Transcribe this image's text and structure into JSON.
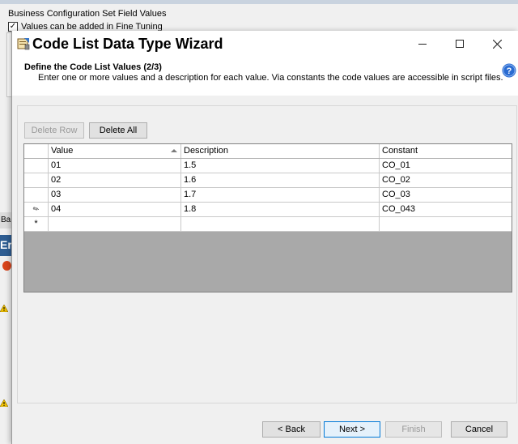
{
  "background": {
    "title": "Business Configuration Set Field Values",
    "checkbox_label": "Values can be added in Fine Tuning",
    "checkbox_checked": true,
    "tab_fragment": "Ba",
    "panel_fragment": "Er"
  },
  "dialog": {
    "title": "Code List Data Type Wizard",
    "step_title": "Define the Code List Values (2/3)",
    "step_description": "Enter one or more values and a description for each value. Via constants the code values are accessible in script files."
  },
  "toolbar": {
    "delete_row": "Delete Row",
    "delete_all": "Delete All"
  },
  "grid": {
    "columns": [
      "Value",
      "Description",
      "Constant"
    ],
    "rows": [
      {
        "value": "01",
        "description": "1.5",
        "constant": "CO_01",
        "marker": ""
      },
      {
        "value": "02",
        "description": "1.6",
        "constant": "CO_02",
        "marker": ""
      },
      {
        "value": "03",
        "description": "1.7",
        "constant": "CO_03",
        "marker": ""
      },
      {
        "value": "04",
        "description": "1.8",
        "constant": "CO_043",
        "marker": "✎"
      }
    ],
    "new_row_marker": "*"
  },
  "footer": {
    "back": "< Back",
    "next": "Next >",
    "finish": "Finish",
    "cancel": "Cancel"
  },
  "icons": {
    "window": "wizard-window-icon",
    "help": "help-icon",
    "warning": "warning-icon"
  },
  "colors": {
    "accent": "#0078d7",
    "help_blue": "#2a6bd1",
    "empty_grid": "#a9a9a9"
  }
}
